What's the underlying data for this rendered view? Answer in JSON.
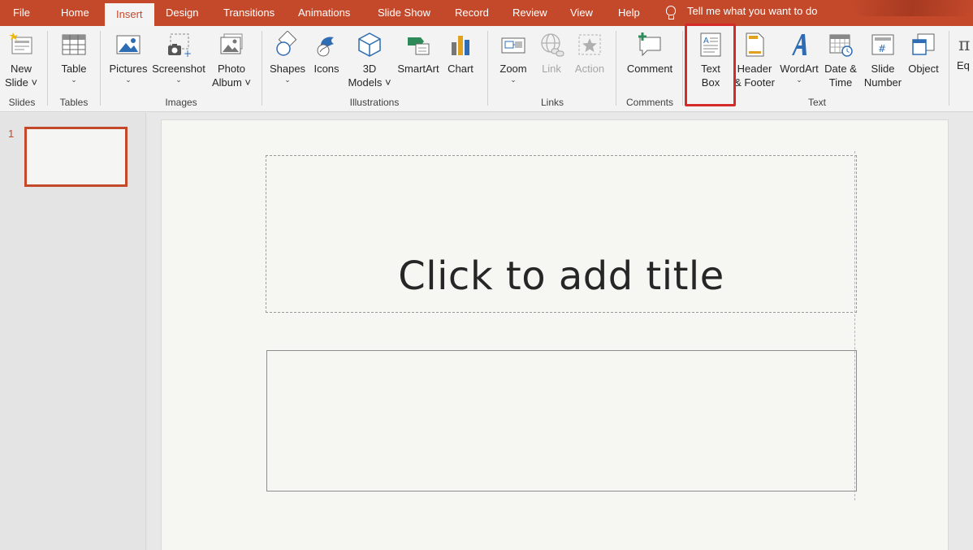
{
  "tabs": [
    {
      "label": "File",
      "active": false
    },
    {
      "label": "Home",
      "active": false
    },
    {
      "label": "Insert",
      "active": true
    },
    {
      "label": "Design",
      "active": false
    },
    {
      "label": "Transitions",
      "active": false
    },
    {
      "label": "Animations",
      "active": false
    },
    {
      "label": "Slide Show",
      "active": false
    },
    {
      "label": "Record",
      "active": false
    },
    {
      "label": "Review",
      "active": false
    },
    {
      "label": "View",
      "active": false
    },
    {
      "label": "Help",
      "active": false
    }
  ],
  "tell_me": "Tell me what you want to do",
  "ribbon": {
    "new_slide": [
      "New",
      "Slide ˅"
    ],
    "table": "Table",
    "pictures": "Pictures",
    "screenshot": "Screenshot",
    "photo_album": [
      "Photo",
      "Album ˅"
    ],
    "shapes": "Shapes",
    "icons": "Icons",
    "models_3d": [
      "3D",
      "Models ˅"
    ],
    "smartart": "SmartArt",
    "chart": "Chart",
    "zoom": "Zoom",
    "link": "Link",
    "action": "Action",
    "comment": "Comment",
    "text_box": [
      "Text",
      "Box"
    ],
    "header_footer": [
      "Header",
      "& Footer"
    ],
    "wordart": "WordArt",
    "date_time": [
      "Date &",
      "Time"
    ],
    "slide_number": [
      "Slide",
      "Number"
    ],
    "object": "Object",
    "equation": "Eq",
    "groups": {
      "slides": "Slides",
      "tables": "Tables",
      "images": "Images",
      "illustrations": "Illustrations",
      "links": "Links",
      "comments": "Comments",
      "text": "Text"
    }
  },
  "thumbnails": [
    {
      "number": "1"
    }
  ],
  "slide": {
    "title_placeholder": "Click to add title"
  },
  "colors": {
    "accent": "#c4492b",
    "highlight": "#d42a2a"
  }
}
